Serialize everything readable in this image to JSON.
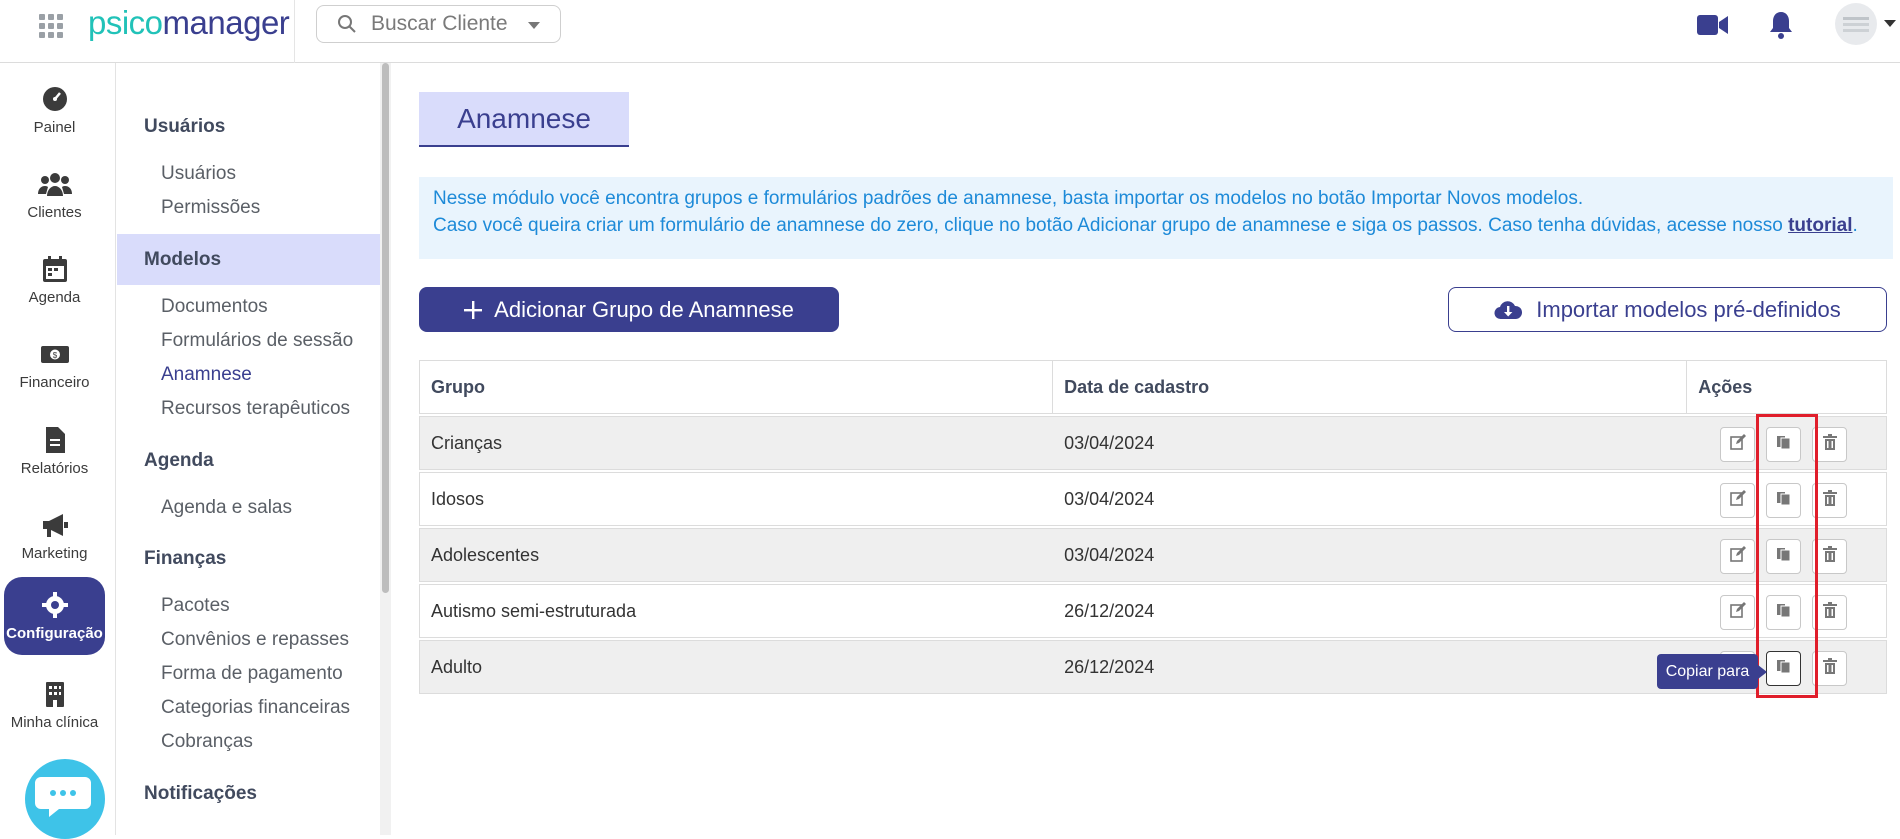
{
  "app": {
    "logo_part1": "psico",
    "logo_part2": "manager"
  },
  "search": {
    "placeholder": "Buscar Cliente"
  },
  "rail": [
    {
      "label": "Painel",
      "icon": "dashboard-icon"
    },
    {
      "label": "Clientes",
      "icon": "users-icon"
    },
    {
      "label": "Agenda",
      "icon": "calendar-icon"
    },
    {
      "label": "Financeiro",
      "icon": "money-icon"
    },
    {
      "label": "Relatórios",
      "icon": "file-icon"
    },
    {
      "label": "Marketing",
      "icon": "megaphone-icon"
    },
    {
      "label": "Configuração",
      "icon": "gear-icon",
      "active": true
    },
    {
      "label": "Minha clínica",
      "icon": "building-icon"
    }
  ],
  "submenu": {
    "usuarios": {
      "title": "Usuários",
      "items": [
        "Usuários",
        "Permissões"
      ]
    },
    "modelos": {
      "title": "Modelos",
      "items": [
        "Documentos",
        "Formulários de sessão",
        "Anamnese",
        "Recursos terapêuticos"
      ]
    },
    "agenda": {
      "title": "Agenda",
      "items": [
        "Agenda e salas"
      ]
    },
    "financas": {
      "title": "Finanças",
      "items": [
        "Pacotes",
        "Convênios e repasses",
        "Forma de pagamento",
        "Categorias financeiras",
        "Cobranças"
      ]
    },
    "notificacoes": {
      "title": "Notificações"
    }
  },
  "page": {
    "title": "Anamnese",
    "info_line1": "Nesse módulo você encontra grupos e formulários padrões de anamnese, basta importar os modelos no botão Importar Novos modelos.",
    "info_line2": "Caso você queira criar um formulário de anamnese do zero, clique no botão Adicionar grupo de anamnese e siga os passos. Caso tenha dúvidas, acesse nosso",
    "info_link": "tutorial",
    "info_end": ".",
    "add_button": "Adicionar Grupo de Anamnese",
    "import_button": "Importar modelos pré-definidos"
  },
  "table": {
    "headers": [
      "Grupo",
      "Data de cadastro",
      "Ações"
    ],
    "rows": [
      {
        "grupo": "Crianças",
        "data": "03/04/2024"
      },
      {
        "grupo": "Idosos",
        "data": "03/04/2024"
      },
      {
        "grupo": "Adolescentes",
        "data": "03/04/2024"
      },
      {
        "grupo": "Autismo semi-estruturada",
        "data": "26/12/2024"
      },
      {
        "grupo": "Adulto",
        "data": "26/12/2024"
      }
    ]
  },
  "tooltip": {
    "text": "Copiar para"
  },
  "colors": {
    "brand": "#3a3f8f",
    "accent": "#21c2b8",
    "info_text": "#1d8ad8",
    "highlight": "#e01e2b"
  }
}
